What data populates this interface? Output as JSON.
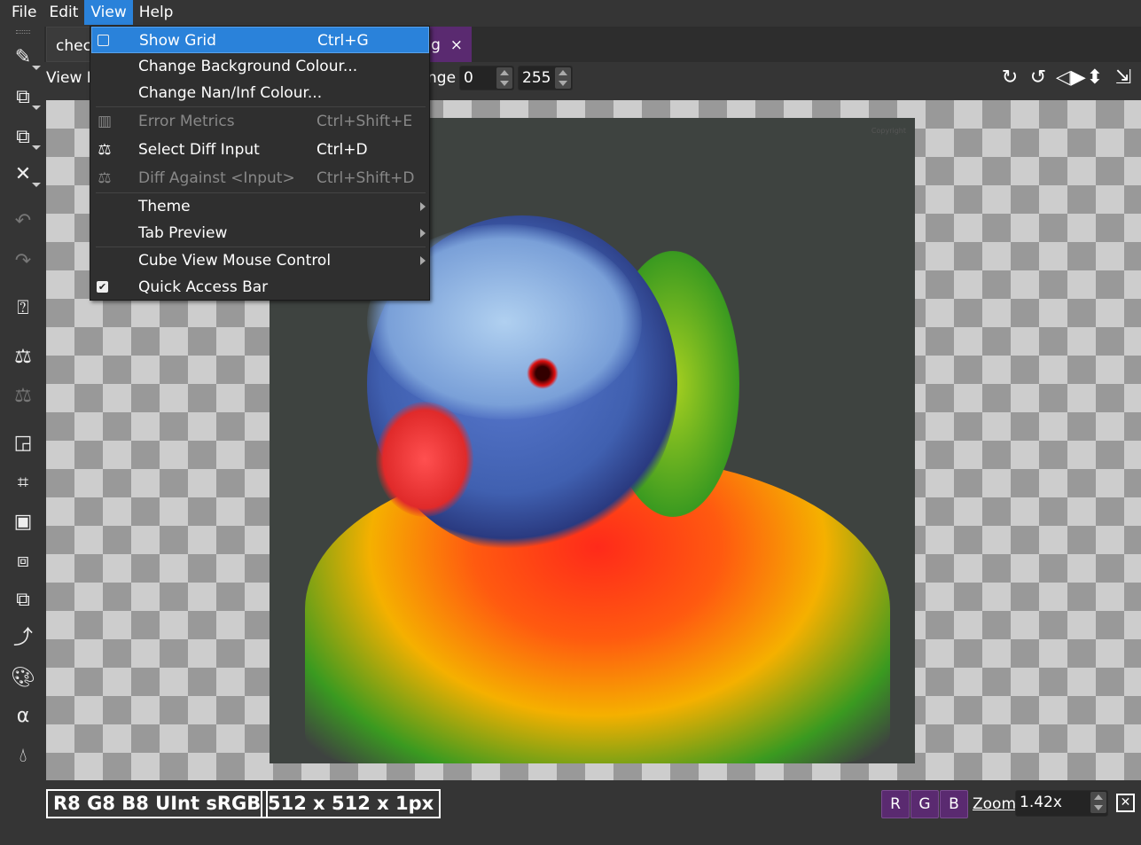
{
  "menubar": {
    "items": [
      "File",
      "Edit",
      "View",
      "Help"
    ],
    "active": "View"
  },
  "tabs": [
    {
      "label": "check"
    },
    {
      "label": "g",
      "close": "×"
    }
  ],
  "viewbar": {
    "view_label": "View M",
    "range_label": "nge",
    "range_min": "0",
    "range_max": "255"
  },
  "view_menu": {
    "items": [
      {
        "label": "Show Grid",
        "shortcut": "Ctrl+G",
        "checkbox": false,
        "highlighted": true
      },
      {
        "label": "Change Background Colour..."
      },
      {
        "label": "Change Nan/Inf Colour..."
      },
      {
        "label": "Error Metrics",
        "shortcut": "Ctrl+Shift+E",
        "disabled": true,
        "icon": "bar-chart-icon"
      },
      {
        "label": "Select Diff Input",
        "shortcut": "Ctrl+D",
        "icon": "scales-icon"
      },
      {
        "label": "Diff Against <Input>",
        "shortcut": "Ctrl+Shift+D",
        "disabled": true,
        "icon": "scales-icon"
      },
      {
        "label": "Theme",
        "submenu": true
      },
      {
        "label": "Tab Preview",
        "submenu": true
      },
      {
        "label": "Cube View Mouse Control",
        "submenu": true
      },
      {
        "label": "Quick Access Bar",
        "checkbox": true
      }
    ]
  },
  "status": {
    "format": "R8 G8 B8 UInt sRGB",
    "dimensions": "512 x 512 x 1px",
    "channels": [
      "R",
      "G",
      "B"
    ],
    "zoom_label": "Zoom",
    "zoom_value": "1.42x"
  },
  "colors": {
    "accent": "#2a82da",
    "channel_button": "#5a2a70",
    "background": "#353535"
  }
}
